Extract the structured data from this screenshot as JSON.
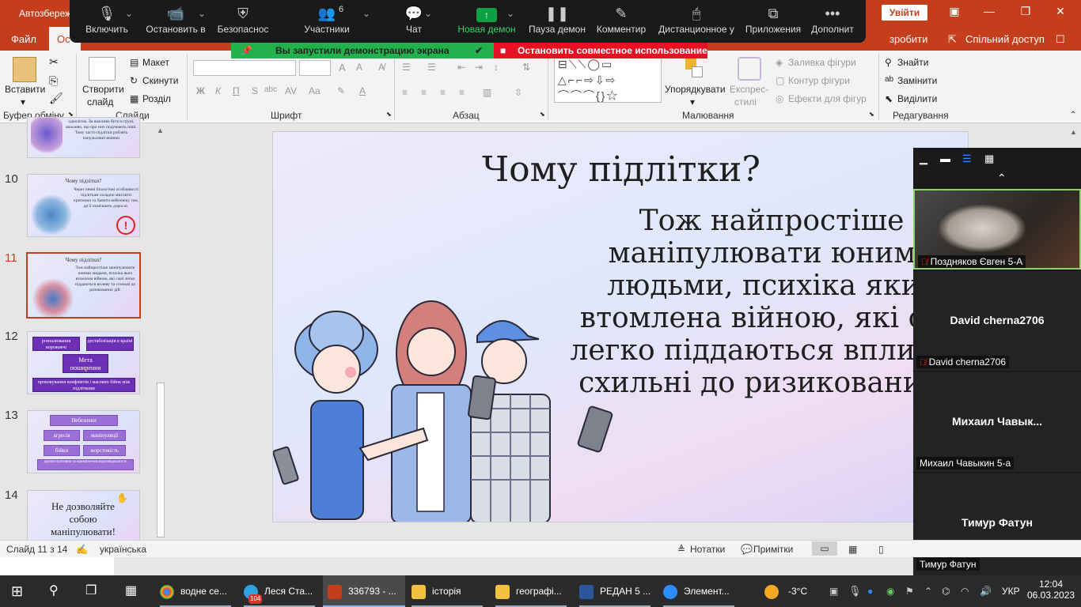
{
  "titlebar": {
    "autosave": "Автозбереж",
    "login": "Увійти"
  },
  "menu": {
    "file": "Файл",
    "active": "Ос",
    "left_label": "Ос",
    "search_hint": "зробити",
    "share": "Спільний доступ"
  },
  "zoom": {
    "buttons": [
      {
        "label": "Включить",
        "icon": "microphone-icon"
      },
      {
        "label": "Остановить в",
        "icon": "video-camera-icon"
      },
      {
        "label": "Безопаснос",
        "icon": "shield-icon"
      },
      {
        "label": "Участники",
        "icon": "participants-icon",
        "count": "6"
      },
      {
        "label": "Чат",
        "icon": "chat-icon"
      },
      {
        "label": "Новая демон",
        "icon": "share-screen-icon"
      },
      {
        "label": "Пауза демон",
        "icon": "pause-icon"
      },
      {
        "label": "Комментир",
        "icon": "pen-icon"
      },
      {
        "label": "Дистанционное у",
        "icon": "mouse-icon"
      },
      {
        "label": "Приложения",
        "icon": "apps-icon"
      },
      {
        "label": "Дополнит",
        "icon": "more-icon"
      }
    ],
    "share_banner": "Вы запустили демонстрацию экрана",
    "stop_banner": "Остановить совместное использование"
  },
  "ribbon": {
    "clipboard": {
      "paste": "Вставити",
      "group": "Буфер обміну"
    },
    "slides": {
      "new_slide_1": "Створити",
      "new_slide_2": "слайд",
      "layout": "Макет",
      "reset": "Скинути",
      "section": "Розділ",
      "group": "Слайди"
    },
    "font": {
      "group": "Шрифт",
      "bold": "Ж",
      "italic": "К",
      "underline": "П",
      "strike": "S",
      "shadow": "abc",
      "spacing": "AV",
      "case": "Aa"
    },
    "paragraph": {
      "group": "Абзац"
    },
    "drawing": {
      "arrange": "Упорядкувати",
      "quick_1": "Експрес-",
      "quick_2": "стилі",
      "fill": "Заливка фігури",
      "outline": "Контур фігури",
      "effects": "Ефекти для фігур",
      "group": "Малювання"
    },
    "editing": {
      "find": "Знайти",
      "replace": "Замінити",
      "select": "Виділити",
      "group": "Редагування"
    }
  },
  "slides": [
    {
      "num": "10",
      "title": "Чому підлітки?",
      "text": "Через певні біологічні особливості підліткам складно мислити критично та бачити небезпеку там, де її помічають дорослі."
    },
    {
      "num": "11",
      "title": "Чому підлітки?",
      "text": "Тож найпростіше маніпулювати юними людьми, психіка яких втомлена війною, які самі легко піддаються впливу та схильні до ризикованих дій."
    },
    {
      "num": "12",
      "pill_a": "розпалювання ворожнечі",
      "pill_b": "дестабілізація в країні",
      "center": "Мета поширення",
      "bottom": "провокування конфліктів і масових бійок між підлітками"
    },
    {
      "num": "13",
      "head": "Небезпеки",
      "p1": "агресія",
      "p2": "маніпуляції",
      "p3": "бійки",
      "p4": "жорстокість",
      "bottom": "адміністративна та кримінальна відповідальність"
    },
    {
      "num": "14",
      "line1": "Не дозволяйте",
      "line2": "собою",
      "line3": "маніпулювати!"
    }
  ],
  "top_thumb_text": "одноліток. Їм важливо бути в групі, важливо, що про них подумають інші. Тому часто підлітки роблять імпульсивні вчинки",
  "main_slide": {
    "title": "Чому підлітки?",
    "lines": [
      "Тож найпростіше",
      "маніпулювати юними",
      "людьми, психіка яких",
      "втомлена війною, які сам",
      "легко піддаються впливу т",
      "схильні до ризикованих д"
    ]
  },
  "video": {
    "tiles": [
      {
        "name": "Поздняков Євген 5-А",
        "big": ""
      },
      {
        "name": "David cherna2706",
        "big": "David cherna2706"
      },
      {
        "name": "Михаил Чавыкин 5-а",
        "big": "Михаил  Чавык..."
      },
      {
        "name": "Тимур Фатун",
        "big": "Тимур Фатун"
      }
    ]
  },
  "status": {
    "slide": "Слайд 11 з 14",
    "lang": "українська",
    "notes": "Нотатки",
    "comments": "Примітки"
  },
  "taskbar": {
    "items": [
      {
        "label": "водне се...",
        "icon": "chrome-icon"
      },
      {
        "label": "Леся Ста...",
        "icon": "telegram-icon",
        "badge": "104"
      },
      {
        "label": "336793 - ...",
        "icon": "powerpoint-icon"
      },
      {
        "label": "історія",
        "icon": "folder-icon"
      },
      {
        "label": "географі...",
        "icon": "folder-icon"
      },
      {
        "label": "РЕДАН 5 ...",
        "icon": "word-icon"
      },
      {
        "label": "Элемент...",
        "icon": "zoom-icon"
      }
    ],
    "temp": "-3°C",
    "lang": "УКР",
    "time": "12:04",
    "date": "06.03.2023"
  }
}
